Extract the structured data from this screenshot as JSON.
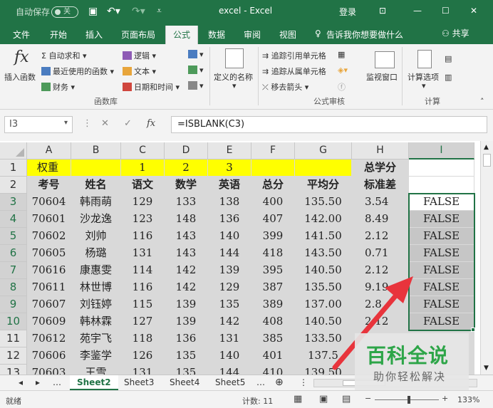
{
  "titlebar": {
    "autosave": "自动保存",
    "toggle": "关",
    "title": "excel - Excel",
    "login": "登录"
  },
  "tabs": [
    "文件",
    "开始",
    "插入",
    "页面布局",
    "公式",
    "数据",
    "审阅",
    "视图"
  ],
  "active_tab": "公式",
  "tell_me": "告诉我你想要做什么",
  "share": "共享",
  "ribbon": {
    "insert_func": "插入函数",
    "fx": "fx",
    "autosum": "自动求和",
    "recent": "最近使用的函数",
    "finance": "财务",
    "logic": "逻辑",
    "text": "文本",
    "datetime": "日期和时间",
    "lib_group": "函数库",
    "define_name": "定义的名称",
    "trace_prec": "追踪引用单元格",
    "trace_dep": "追踪从属单元格",
    "remove_arrows": "移去箭头",
    "audit_group": "公式审核",
    "watch": "监视窗口",
    "calc_options": "计算选项",
    "calc_group": "计算"
  },
  "formula": {
    "namebox": "I3",
    "fx_label": "fx",
    "content": "=ISBLANK(C3)"
  },
  "columns": [
    "A",
    "B",
    "C",
    "D",
    "E",
    "F",
    "G",
    "H",
    "I"
  ],
  "rows": [
    "1",
    "2",
    "3",
    "4",
    "5",
    "6",
    "7",
    "8",
    "9",
    "10",
    "11",
    "12",
    "13"
  ],
  "row1": {
    "a": "权重",
    "c": "1",
    "d": "2",
    "e": "3",
    "h": "总学分"
  },
  "headers": {
    "a": "考号",
    "b": "姓名",
    "c": "语文",
    "d": "数学",
    "e": "英语",
    "f": "总分",
    "g": "平均分",
    "h": "标准差"
  },
  "data": [
    [
      "70604",
      "韩雨萌",
      "129",
      "133",
      "138",
      "400",
      "135.50",
      "3.54",
      "FALSE"
    ],
    [
      "70601",
      "沙龙逸",
      "123",
      "148",
      "136",
      "407",
      "142.00",
      "8.49",
      "FALSE"
    ],
    [
      "70602",
      "刘帅",
      "116",
      "143",
      "140",
      "399",
      "141.50",
      "2.12",
      "FALSE"
    ],
    [
      "70605",
      "杨璐",
      "131",
      "143",
      "144",
      "418",
      "143.50",
      "0.71",
      "FALSE"
    ],
    [
      "70616",
      "康惠雯",
      "114",
      "142",
      "139",
      "395",
      "140.50",
      "2.12",
      "FALSE"
    ],
    [
      "70611",
      "林世博",
      "116",
      "142",
      "129",
      "387",
      "135.50",
      "9.19",
      "FALSE"
    ],
    [
      "70607",
      "刘钰婷",
      "115",
      "139",
      "135",
      "389",
      "137.00",
      "2.8",
      "FALSE"
    ],
    [
      "70609",
      "韩林霖",
      "127",
      "139",
      "142",
      "408",
      "140.50",
      "2.12",
      "FALSE"
    ],
    [
      "70612",
      "苑宇飞",
      "118",
      "136",
      "131",
      "385",
      "133.50",
      "",
      ""
    ],
    [
      "70606",
      "李鉴学",
      "126",
      "135",
      "140",
      "401",
      "137.5",
      "",
      ""
    ],
    [
      "70603",
      "王雪",
      "131",
      "135",
      "144",
      "410",
      "139.50",
      "",
      ""
    ]
  ],
  "sheets": [
    "Sheet2",
    "Sheet3",
    "Sheet4",
    "Sheet5"
  ],
  "active_sheet": "Sheet2",
  "status": {
    "ready": "就绪",
    "count": "计数: 11",
    "zoom": "133%"
  },
  "watermark": {
    "title": "百科全说",
    "subtitle": "助你轻松解决"
  },
  "colors": {
    "green": "#217346",
    "yellow": "#ffff00",
    "sel_fill": "#c6c6c6",
    "arrow": "#e8343c"
  }
}
